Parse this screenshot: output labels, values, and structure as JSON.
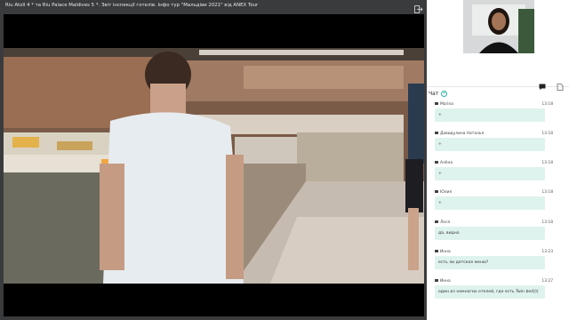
{
  "title_bar": {
    "text": "Riu Atoll 4 * та Riu Palace Maldives 5 *. Звіт інспекції готелів. Інфо тур  \"Мальдіви 2021\" від ANEX Tour"
  },
  "chat": {
    "title": "Чат",
    "messages": [
      {
        "author": "Marina",
        "time": "13:18",
        "text": "+"
      },
      {
        "author": "Давидулина Наталья",
        "time": "13:18",
        "text": "+"
      },
      {
        "author": "Алёна",
        "time": "13:18",
        "text": "+"
      },
      {
        "author": "Юлия",
        "time": "13:18",
        "text": "+"
      },
      {
        "author": "Леся",
        "time": "13:18",
        "text": "да, видно"
      },
      {
        "author": "Инна",
        "time": "13:23",
        "text": "есть ли детское меню?"
      },
      {
        "author": "Инна",
        "time": "13:27",
        "text": "один из немногих отелей, где есть Twin bed)))"
      }
    ]
  },
  "colors": {
    "accent": "#2ab3a6",
    "bubble": "#dff3ee",
    "titlebar": "#3a3b3d"
  },
  "icons": {
    "exit": "exit-icon",
    "chat_tab": "chat-bubble-icon",
    "file_tab": "document-icon",
    "add": "add-circle-icon"
  }
}
